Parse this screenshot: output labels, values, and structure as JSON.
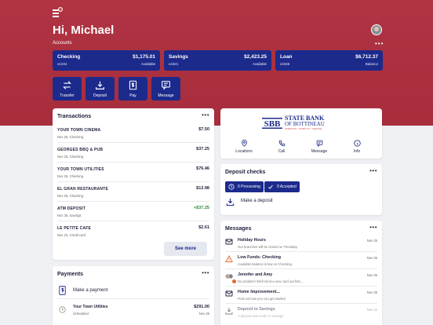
{
  "header": {
    "greeting": "Hi, Michael",
    "accounts_label": "Accounts",
    "more": "•••"
  },
  "accounts": [
    {
      "name": "Checking",
      "number": "x1234",
      "amount": "$1,175.01",
      "kind": "Available"
    },
    {
      "name": "Savings",
      "number": "x4321",
      "amount": "$2,423.25",
      "kind": "Available"
    },
    {
      "name": "Loan",
      "number": "x2345",
      "amount": "$6,712.37",
      "kind": "Balance"
    }
  ],
  "quick_actions": [
    {
      "label": "Transfer",
      "icon": "transfer-icon"
    },
    {
      "label": "Deposit",
      "icon": "download-icon"
    },
    {
      "label": "Pay",
      "icon": "dollar-document-icon"
    },
    {
      "label": "Message",
      "icon": "message-icon"
    }
  ],
  "transactions": {
    "title": "Transactions",
    "more": "•••",
    "items": [
      {
        "name": "YOUR TOWN CINEMA",
        "sub": "Nov 25, Checking",
        "amount": "$7.50",
        "balance": "",
        "positive": false
      },
      {
        "name": "GEORGES BBQ & PUB",
        "sub": "Nov 25, Checking",
        "amount": "$37.25",
        "balance": "",
        "positive": false
      },
      {
        "name": "YOUR TOWN UTILITIES",
        "sub": "Nov 25, Checking",
        "amount": "$76.46",
        "balance": "",
        "positive": false
      },
      {
        "name": "EL GRAN RESTAURANTE",
        "sub": "Nov 25, Checking",
        "amount": "$13.98",
        "balance": "",
        "positive": false
      },
      {
        "name": "ATM DEPOSIT",
        "sub": "Nov 25, Savings",
        "amount": "+$37.25",
        "balance": "",
        "positive": true
      },
      {
        "name": "LE PETITE CAFE",
        "sub": "Nov 24, Credit card",
        "amount": "$2.61",
        "balance": "",
        "positive": false
      }
    ],
    "see_more": "See more"
  },
  "payments": {
    "title": "Payments",
    "more": "•••",
    "make_payment": "Make a payment",
    "items": [
      {
        "payee": "Your Town Utilities",
        "status": "Scheduled",
        "amount": "$291.00",
        "date": "Nov 26"
      }
    ]
  },
  "bank": {
    "monogram": "SBB",
    "name_line1": "STATE BANK",
    "name_line2": "OF BOTTINEAU",
    "tagline": "STRENGTH • STABILITY • SERVICE",
    "actions": [
      {
        "label": "Locations",
        "icon": "location-pin-icon"
      },
      {
        "label": "Call",
        "icon": "phone-icon"
      },
      {
        "label": "Message",
        "icon": "message-icon"
      },
      {
        "label": "Info",
        "icon": "info-icon"
      }
    ]
  },
  "deposit_checks": {
    "title": "Deposit checks",
    "more": "•••",
    "processing": "0 Processing",
    "accepted": "9 Accepted",
    "make_deposit": "Make a deposit"
  },
  "messages": {
    "title": "Messages",
    "more": "•••",
    "items": [
      {
        "title": "Holiday Hours",
        "body": "Our branches will be closed on Thursday.",
        "date": "Nov 25",
        "icon": "envelope-icon"
      },
      {
        "title": "Low Funds: Checking",
        "body": "Available balance is low on Checking.",
        "date": "Nov 25",
        "icon": "warning-icon"
      },
      {
        "title": "Jennifer and Amy",
        "body": "No problem! We'll send a new card out first...",
        "date": "Nov 25",
        "icon": "people-icon"
      },
      {
        "title": "Home Improvement...",
        "body": "Find out how you can get started",
        "date": "Nov 25",
        "icon": "envelope-icon"
      },
      {
        "title": "Deposit to Savings",
        "body": "A deposit was made to Savings",
        "date": "Nov 22",
        "icon": "deposit-icon"
      }
    ]
  },
  "colors": {
    "hero": "#a72d3c",
    "accent": "#1c2a8c",
    "positive": "#2e8a3a",
    "warning": "#e8662c"
  }
}
